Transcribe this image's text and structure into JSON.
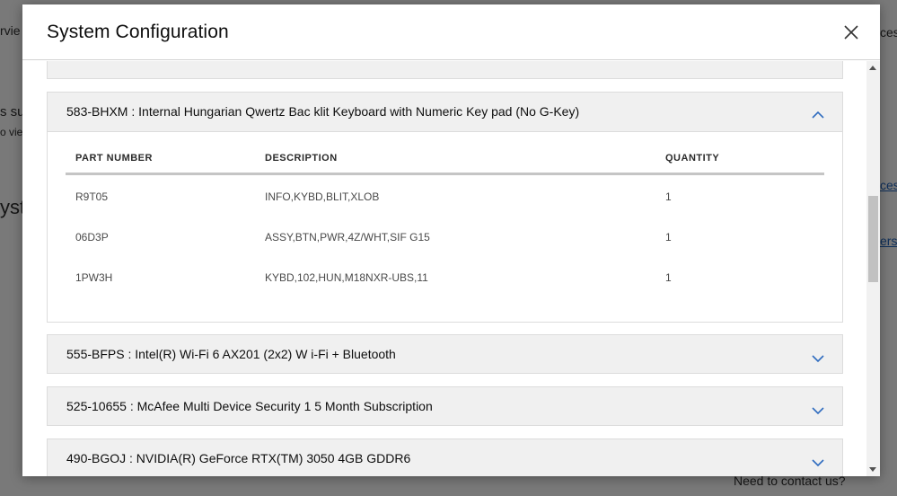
{
  "background": {
    "fragments": [
      "rvie",
      "s su",
      "o vie",
      "yst",
      "ces",
      "ces",
      "ersh",
      "Need to contact us?"
    ]
  },
  "modal": {
    "title": "System Configuration",
    "close_label": "Close"
  },
  "table": {
    "headers": [
      "PART NUMBER",
      "DESCRIPTION",
      "QUANTITY"
    ]
  },
  "accordion": [
    {
      "title": "583-BHXM : Internal Hungarian Qwertz Bac klit Keyboard with Numeric Key pad (No G-Key)",
      "expanded": true,
      "rows": [
        {
          "part": "R9T05",
          "description": "INFO,KYBD,BLIT,XLOB",
          "quantity": "1"
        },
        {
          "part": "06D3P",
          "description": "ASSY,BTN,PWR,4Z/WHT,SIF G15",
          "quantity": "1"
        },
        {
          "part": "1PW3H",
          "description": "KYBD,102,HUN,M18NXR-UBS,11",
          "quantity": "1"
        }
      ]
    },
    {
      "title": "555-BFPS : Intel(R) Wi-Fi 6 AX201 (2x2) W i-Fi + Bluetooth",
      "expanded": false
    },
    {
      "title": "525-10655 : McAfee Multi Device Security 1 5 Month Subscription",
      "expanded": false
    },
    {
      "title": "490-BGOJ : NVIDIA(R) GeForce RTX(TM) 3050 4GB GDDR6",
      "expanded": false
    }
  ],
  "colors": {
    "chevron": "#2e6bbf",
    "header_bg": "#f0f0f0",
    "divider": "#c5c5c5"
  },
  "icons": {
    "close": "close-icon",
    "expand": "chevron-down-icon",
    "collapse": "chevron-up-icon"
  }
}
